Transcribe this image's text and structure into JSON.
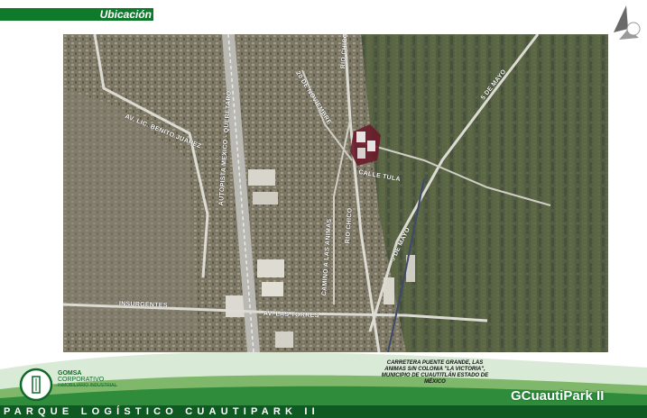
{
  "header": {
    "title": "Ubicación"
  },
  "map": {
    "labels": {
      "av_benito_juarez": "AV. LIC. BENITO JUAREZ",
      "autopista": "AUTOPISTA MEXICO - QUERETARO",
      "de_noviembre": "20 DE NOVIEMBRE",
      "rio_chico_top": "RIO CHICO",
      "de_mayo_top": "5 DE MAYO",
      "calle_tula": "CALLE TULA",
      "camino_animas": "CAMINO A LAS ANIMAS",
      "rio_chico_mid": "RIO CHICO",
      "de_mayo_mid": "5 DE MAYO",
      "insurgentes": "INSURGENTES",
      "av_las_torres": "AV. LAS TORRES"
    }
  },
  "address": {
    "line1": "CARRETERA PUENTE GRANDE, LAS",
    "line2": "ANIMAS S/N COLONIA \"LA VICTORIA\",",
    "line3": "MUNICIPIO DE CUAUTITLÁN ESTADO DE",
    "line4": "MÉXICO"
  },
  "footer": {
    "company_line1": "GOMSA",
    "company_line2": "CORPORATIVO",
    "company_line3": "INMOBILIARIO INDUSTRIAL",
    "brand_prefix": "G",
    "brand_name": "Cuauti",
    "brand_suffix": "Park II",
    "strip_text": "PARQUE LOGÍSTICO CUAUTIPARK II"
  },
  "colors": {
    "accent": "#0f7a2c",
    "dark_accent": "#0f5a23"
  }
}
